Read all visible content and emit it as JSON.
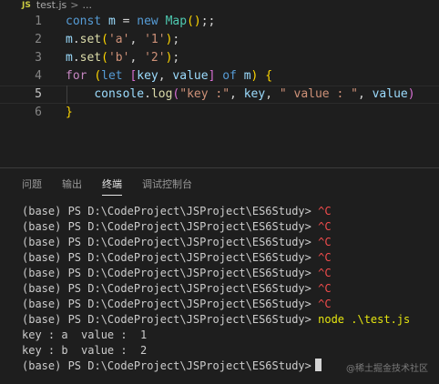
{
  "breadcrumb": {
    "file_icon": "JS",
    "file_name": "test.js",
    "separator": ">",
    "more": "..."
  },
  "editor": {
    "lines": [
      {
        "number": "1",
        "tokens": [
          [
            "kw",
            "const"
          ],
          [
            "pl",
            " "
          ],
          [
            "var",
            "m"
          ],
          [
            "pl",
            " = "
          ],
          [
            "kw",
            "new"
          ],
          [
            "pl",
            " "
          ],
          [
            "cls",
            "Map"
          ],
          [
            "brk",
            "("
          ],
          [
            "brk",
            ")"
          ],
          [
            "pl",
            ";;"
          ]
        ]
      },
      {
        "number": "2",
        "tokens": [
          [
            "var",
            "m"
          ],
          [
            "pl",
            "."
          ],
          [
            "fn",
            "set"
          ],
          [
            "brk",
            "("
          ],
          [
            "str",
            "'a'"
          ],
          [
            "pl",
            ", "
          ],
          [
            "str",
            "'1'"
          ],
          [
            "brk",
            ")"
          ],
          [
            "pl",
            ";"
          ]
        ]
      },
      {
        "number": "3",
        "tokens": [
          [
            "var",
            "m"
          ],
          [
            "pl",
            "."
          ],
          [
            "fn",
            "set"
          ],
          [
            "brk",
            "("
          ],
          [
            "str",
            "'b'"
          ],
          [
            "pl",
            ", "
          ],
          [
            "str",
            "'2'"
          ],
          [
            "brk",
            ")"
          ],
          [
            "pl",
            ";"
          ]
        ]
      },
      {
        "number": "4",
        "tokens": [
          [
            "ctl",
            "for"
          ],
          [
            "pl",
            " "
          ],
          [
            "brk",
            "("
          ],
          [
            "kw",
            "let"
          ],
          [
            "pl",
            " "
          ],
          [
            "brk2",
            "["
          ],
          [
            "var",
            "key"
          ],
          [
            "pl",
            ", "
          ],
          [
            "var",
            "value"
          ],
          [
            "brk2",
            "]"
          ],
          [
            "pl",
            " "
          ],
          [
            "kw",
            "of"
          ],
          [
            "pl",
            " "
          ],
          [
            "var",
            "m"
          ],
          [
            "brk",
            ")"
          ],
          [
            "pl",
            " "
          ],
          [
            "brk",
            "{"
          ]
        ]
      },
      {
        "number": "5",
        "tokens": [
          [
            "pl",
            "    "
          ],
          [
            "var",
            "console"
          ],
          [
            "pl",
            "."
          ],
          [
            "fn",
            "log"
          ],
          [
            "brk2",
            "("
          ],
          [
            "str",
            "\"key :\""
          ],
          [
            "pl",
            ", "
          ],
          [
            "var",
            "key"
          ],
          [
            "pl",
            ", "
          ],
          [
            "str",
            "\" value : \""
          ],
          [
            "pl",
            ", "
          ],
          [
            "var",
            "value"
          ],
          [
            "brk2",
            ")"
          ]
        ],
        "active": true
      },
      {
        "number": "6",
        "tokens": [
          [
            "brk",
            "}"
          ]
        ]
      }
    ]
  },
  "panel": {
    "tabs": [
      {
        "label": "问题",
        "active": false
      },
      {
        "label": "输出",
        "active": false
      },
      {
        "label": "终端",
        "active": true
      },
      {
        "label": "调试控制台",
        "active": false
      }
    ]
  },
  "terminal": {
    "prompt": "(base) PS D:\\CodeProject\\JSProject\\ES6Study>",
    "ctrl_c": "^C",
    "command": "node .\\test.js",
    "output": [
      "key : a  value :  1",
      "key : b  value :  2"
    ],
    "ctrl_c_count": 7
  },
  "watermark": "@稀土掘金技术社区",
  "colors": {
    "background": "#1e1e1e",
    "ctrl_c": "#f14c4c",
    "command": "#e5e510"
  }
}
